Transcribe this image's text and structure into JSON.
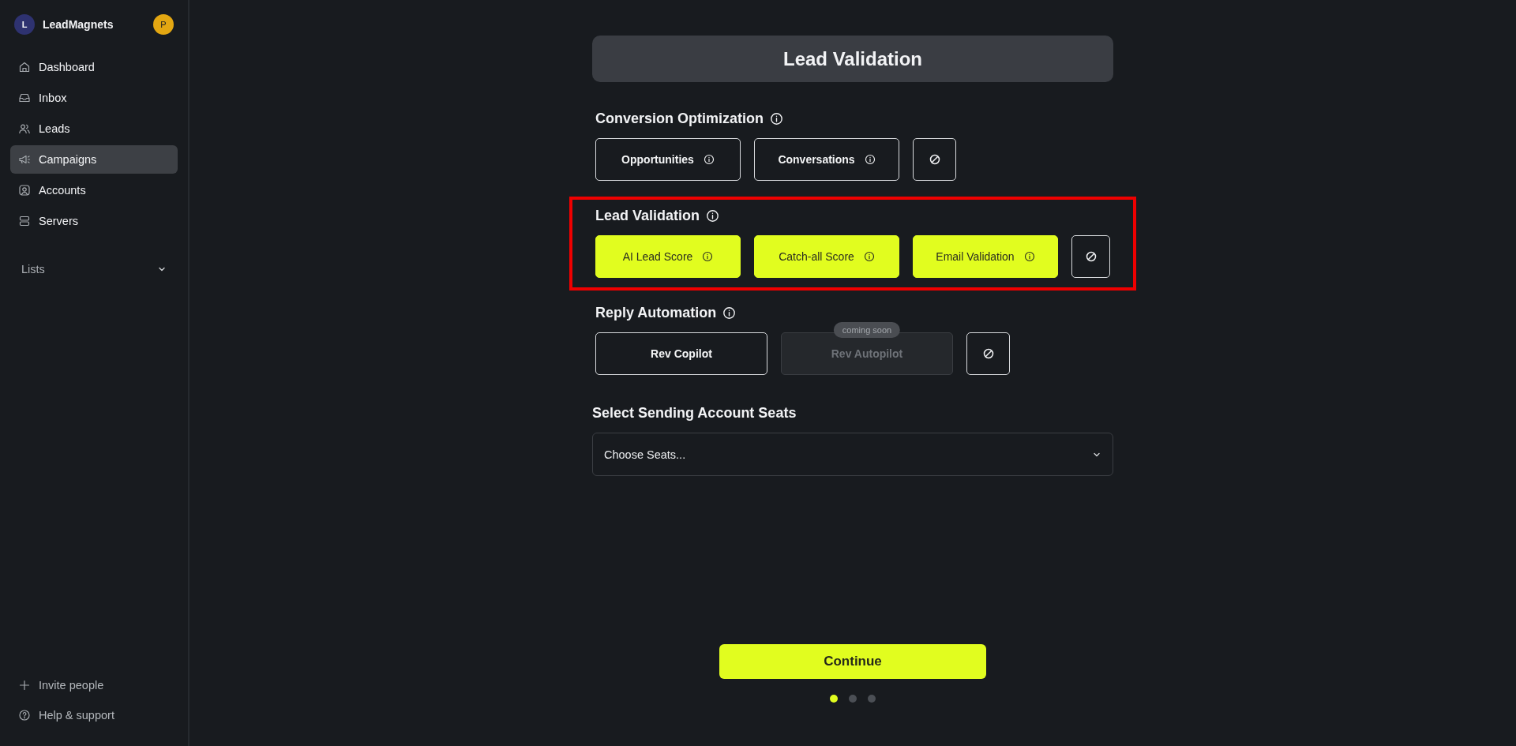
{
  "sidebar": {
    "brand": {
      "initial": "L",
      "name": "LeadMagnets"
    },
    "user_initial": "P",
    "items": [
      {
        "label": "Dashboard",
        "selected": false
      },
      {
        "label": "Inbox",
        "selected": false
      },
      {
        "label": "Leads",
        "selected": false
      },
      {
        "label": "Campaigns",
        "selected": true
      },
      {
        "label": "Accounts",
        "selected": false
      },
      {
        "label": "Servers",
        "selected": false
      }
    ],
    "lists": {
      "label": "Lists",
      "expanded": false
    },
    "footer": [
      {
        "label": "Invite people"
      },
      {
        "label": "Help & support"
      }
    ]
  },
  "page_title": "Lead Validation",
  "sections": [
    {
      "title": "Conversion Optimization",
      "highlighted": false,
      "options": [
        {
          "kind": "option",
          "label": "Opportunities",
          "info": true,
          "selected": false,
          "disabled": false
        },
        {
          "kind": "option",
          "label": "Conversations",
          "info": true,
          "selected": false,
          "disabled": false
        },
        {
          "kind": "none",
          "selected": false
        }
      ]
    },
    {
      "title": "Lead Validation",
      "highlighted": true,
      "options": [
        {
          "kind": "option",
          "label": "AI Lead Score",
          "info": true,
          "selected": true,
          "disabled": false
        },
        {
          "kind": "option",
          "label": "Catch-all Score",
          "info": true,
          "selected": true,
          "disabled": false
        },
        {
          "kind": "option",
          "label": "Email Validation",
          "info": true,
          "selected": true,
          "disabled": false
        },
        {
          "kind": "none",
          "selected": false
        }
      ]
    },
    {
      "title": "Reply Automation",
      "highlighted": false,
      "options": [
        {
          "kind": "option",
          "label": "Rev Copilot",
          "info": false,
          "selected": false,
          "disabled": false
        },
        {
          "kind": "option",
          "label": "Rev Autopilot",
          "info": false,
          "selected": false,
          "disabled": true,
          "badge": "coming soon"
        },
        {
          "kind": "none",
          "selected": false
        }
      ]
    }
  ],
  "seats": {
    "title": "Select Sending Account Seats",
    "placeholder": "Choose Seats..."
  },
  "continue": "Continue",
  "steps": [
    {
      "selected": true
    },
    {
      "selected": false
    },
    {
      "selected": false
    }
  ]
}
